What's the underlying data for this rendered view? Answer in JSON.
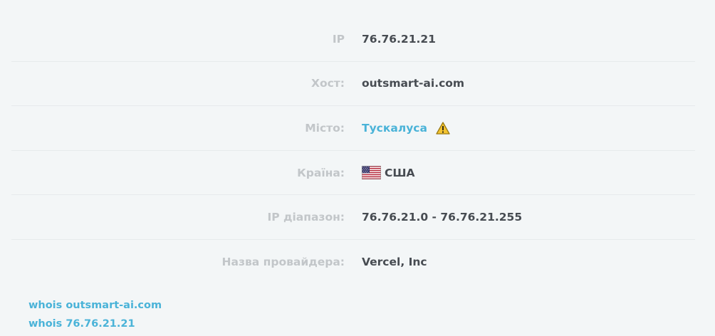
{
  "rows": [
    {
      "label": "IP",
      "value": "76.76.21.21"
    },
    {
      "label": "Хост:",
      "value": "outsmart-ai.com"
    },
    {
      "label": "Місто:",
      "value": "Тускалуса"
    },
    {
      "label": "Країна:",
      "value": "США",
      "flag": "us-flag-icon"
    },
    {
      "label": "IP діапазон:",
      "value": "76.76.21.0 - 76.76.21.255"
    },
    {
      "label": "Назва провайдера:",
      "value": "Vercel, Inc"
    }
  ],
  "whois": [
    "whois outsmart-ai.com",
    "whois 76.76.21.21"
  ],
  "colors": {
    "background": "#f3f6f7",
    "label": "#c2c6c9",
    "value": "#474c52",
    "link": "#4ab3d8",
    "warning": "#f4c430"
  }
}
